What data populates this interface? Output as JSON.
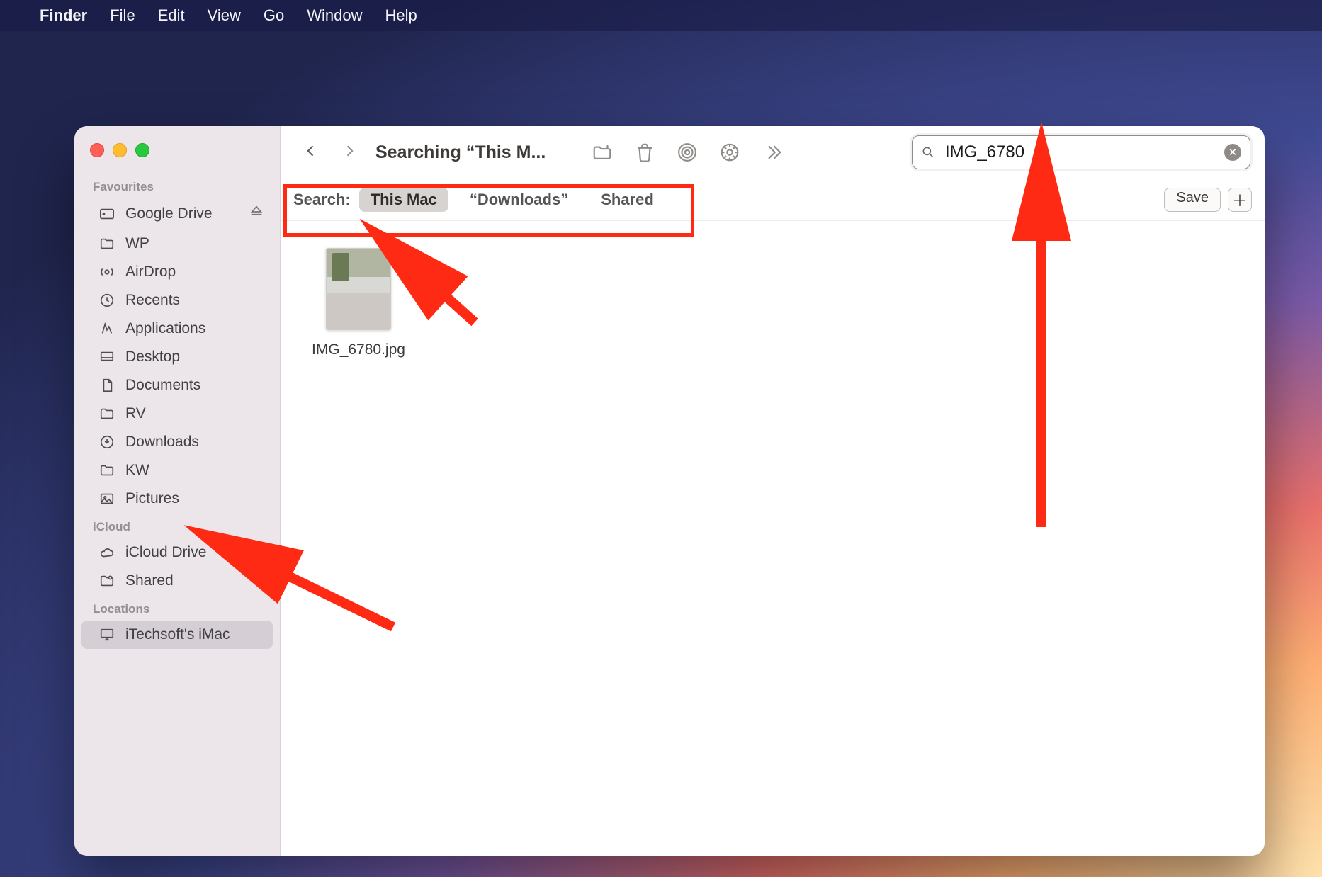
{
  "menubar": {
    "app": "Finder",
    "items": [
      "File",
      "Edit",
      "View",
      "Go",
      "Window",
      "Help"
    ]
  },
  "sidebar": {
    "sections": [
      {
        "title": "Favourites",
        "items": [
          {
            "icon": "gdrive",
            "label": "Google Drive",
            "eject": true
          },
          {
            "icon": "folder",
            "label": "WP"
          },
          {
            "icon": "airdrop",
            "label": "AirDrop"
          },
          {
            "icon": "clock",
            "label": "Recents"
          },
          {
            "icon": "apps",
            "label": "Applications"
          },
          {
            "icon": "desktop",
            "label": "Desktop"
          },
          {
            "icon": "doc",
            "label": "Documents"
          },
          {
            "icon": "folder",
            "label": "RV"
          },
          {
            "icon": "download",
            "label": "Downloads"
          },
          {
            "icon": "folder",
            "label": "KW"
          },
          {
            "icon": "picture",
            "label": "Pictures"
          }
        ]
      },
      {
        "title": "iCloud",
        "items": [
          {
            "icon": "cloud",
            "label": "iCloud Drive"
          },
          {
            "icon": "shared",
            "label": "Shared"
          }
        ]
      },
      {
        "title": "Locations",
        "items": [
          {
            "icon": "imac",
            "label": "iTechsoft's iMac",
            "selected": true
          }
        ]
      }
    ]
  },
  "toolbar": {
    "title": "Searching “This M..."
  },
  "search": {
    "value": "IMG_6780",
    "placeholder": "Search"
  },
  "scope": {
    "label": "Search:",
    "options": [
      "This Mac",
      "“Downloads”",
      "Shared"
    ],
    "selected": 0,
    "save": "Save"
  },
  "results": [
    {
      "filename": "IMG_6780.jpg"
    }
  ]
}
